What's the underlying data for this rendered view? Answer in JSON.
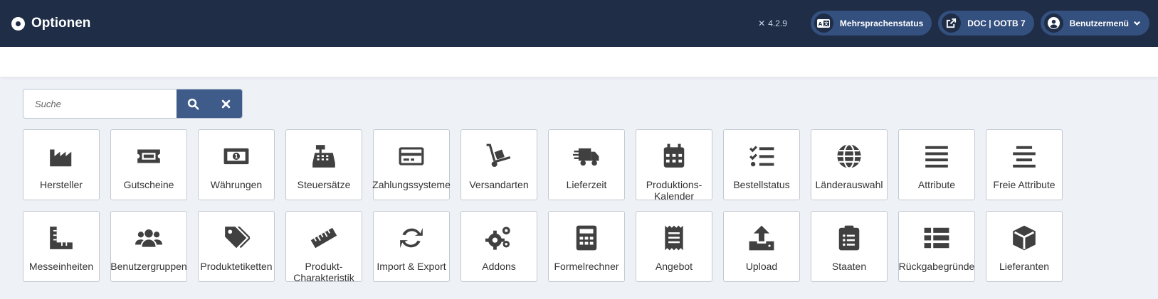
{
  "header": {
    "title": "Optionen",
    "version": "4.2.9",
    "language_button": "Mehrsprachenstatus",
    "doc_button": "DOC | OOTB 7",
    "user_menu": "Benutzermenü",
    "background": "#1f2d47",
    "pill_color": "#34507f"
  },
  "search": {
    "placeholder": "Suche",
    "value": "",
    "search_icon": "search-icon",
    "clear_icon": "close-icon"
  },
  "tiles": [
    {
      "label": "Hersteller",
      "icon": "factory-icon"
    },
    {
      "label": "Gutscheine",
      "icon": "ticket-icon"
    },
    {
      "label": "Währungen",
      "icon": "money-bill-icon"
    },
    {
      "label": "Steuersätze",
      "icon": "cash-register-icon"
    },
    {
      "label": "Zahlungssysteme",
      "icon": "credit-card-icon"
    },
    {
      "label": "Versandarten",
      "icon": "dolly-icon"
    },
    {
      "label": "Lieferzeit",
      "icon": "truck-fast-icon"
    },
    {
      "label": "Produktions-\nKalender",
      "icon": "calendar-icon"
    },
    {
      "label": "Bestellstatus",
      "icon": "list-check-icon"
    },
    {
      "label": "Länderauswahl",
      "icon": "globe-icon"
    },
    {
      "label": "Attribute",
      "icon": "bars-icon"
    },
    {
      "label": "Freie Attribute",
      "icon": "align-center-icon"
    },
    {
      "label": "Messeinheiten",
      "icon": "ruler-combined-icon"
    },
    {
      "label": "Benutzergruppen",
      "icon": "users-icon"
    },
    {
      "label": "Produktetiketten",
      "icon": "tags-icon"
    },
    {
      "label": "Produkt-\nCharakteristik",
      "icon": "ruler-icon"
    },
    {
      "label": "Import & Export",
      "icon": "sync-icon"
    },
    {
      "label": "Addons",
      "icon": "cogs-icon"
    },
    {
      "label": "Formelrechner",
      "icon": "calculator-icon"
    },
    {
      "label": "Angebot",
      "icon": "receipt-icon"
    },
    {
      "label": "Upload",
      "icon": "upload-icon"
    },
    {
      "label": "Staaten",
      "icon": "clipboard-list-icon"
    },
    {
      "label": "Rückgabegründe",
      "icon": "table-list-icon"
    },
    {
      "label": "Lieferanten",
      "icon": "box-icon"
    }
  ]
}
